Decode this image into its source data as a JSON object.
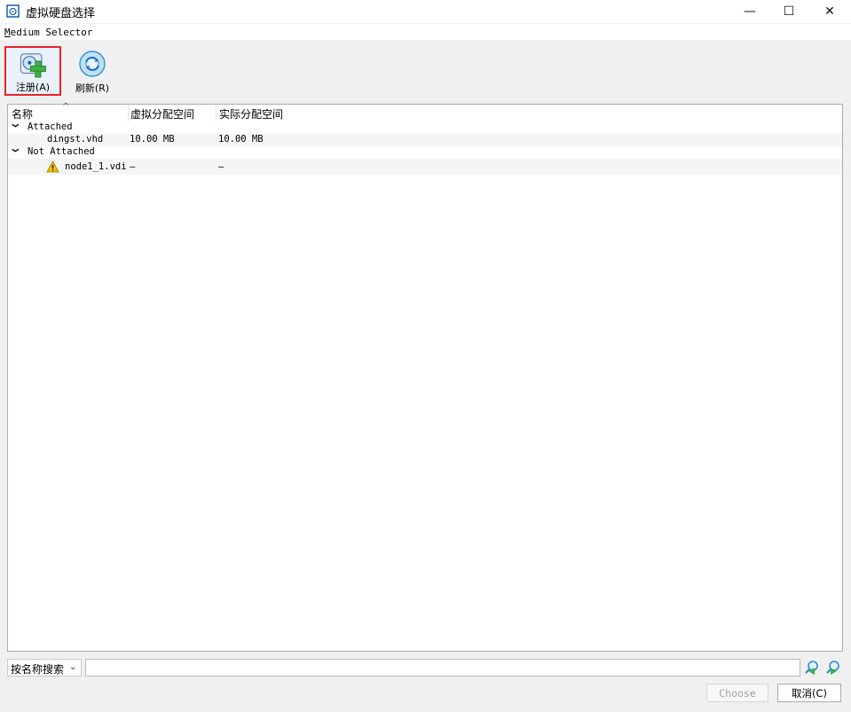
{
  "window": {
    "title": "虚拟硬盘选择",
    "controls": {
      "minimize": "—",
      "maximize": "☐",
      "close": "✕"
    }
  },
  "menubar": {
    "item_underlined": "M",
    "item_rest": "edium Selector"
  },
  "toolbar": {
    "register_label": "注册(A)",
    "refresh_label": "刷新(R)"
  },
  "table": {
    "columns": [
      "名称",
      "虚拟分配空间",
      "实际分配空间"
    ],
    "groups": [
      {
        "name": "Attached",
        "items": [
          {
            "name": "dingst.vhd",
            "virtual": "10.00 MB",
            "actual": "10.00 MB",
            "warning": false
          }
        ]
      },
      {
        "name": "Not Attached",
        "items": [
          {
            "name": "node1_1.vdi",
            "virtual": "—",
            "actual": "—",
            "warning": true
          }
        ]
      }
    ]
  },
  "search": {
    "mode": "按名称搜索",
    "value": ""
  },
  "buttons": {
    "choose": "Choose",
    "cancel": "取消(C)"
  },
  "colors": {
    "highlight_border": "#e8232a",
    "warning": "#f5c400",
    "accent_green": "#3cb043",
    "accent_blue": "#2a86d6"
  }
}
